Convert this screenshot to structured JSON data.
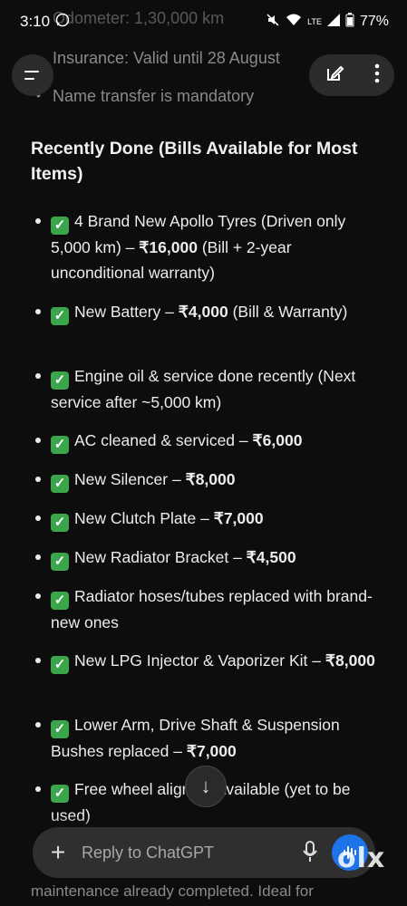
{
  "status_bar": {
    "time": "3:10",
    "battery": "77%",
    "network": "LTE"
  },
  "top_lines": [
    "Odometer: 1,30,000 km",
    "Insurance: Valid until 28 August",
    "Name transfer is mandatory"
  ],
  "section_heading": "Recently Done (Bills Available for Most Items)",
  "items": [
    {
      "pre": "4 Brand New Apollo Tyres (Driven only 5,000 km) – ",
      "bold": "₹16,000",
      "post": " (Bill + 2-year unconditional warranty)"
    },
    {
      "pre": "New Battery – ",
      "bold": "₹4,000",
      "post": " (Bill & Warranty)"
    },
    {
      "pre": "Engine oil & service done recently (Next service after ~5,000 km)",
      "bold": "",
      "post": ""
    },
    {
      "pre": "AC cleaned & serviced – ",
      "bold": "₹6,000",
      "post": ""
    },
    {
      "pre": "New Silencer – ",
      "bold": "₹8,000",
      "post": ""
    },
    {
      "pre": "New Clutch Plate – ",
      "bold": "₹7,000",
      "post": ""
    },
    {
      "pre": "New Radiator Bracket – ",
      "bold": "₹4,500",
      "post": ""
    },
    {
      "pre": "Radiator hoses/tubes replaced with brand-new ones",
      "bold": "",
      "post": ""
    },
    {
      "pre": "New LPG Injector & Vaporizer Kit – ",
      "bold": "₹8,000",
      "post": ""
    },
    {
      "pre": "Lower Arm, Drive Shaft & Suspension Bushes replaced – ",
      "bold": "₹7,000",
      "post": ""
    },
    {
      "pre": "Free wheel alig",
      "bold": "",
      "post": "nent available (yet to be used)"
    }
  ],
  "composer": {
    "placeholder": "Reply to ChatGPT"
  },
  "footer_text": "maintenance already completed. Ideal for",
  "watermark": "olx"
}
